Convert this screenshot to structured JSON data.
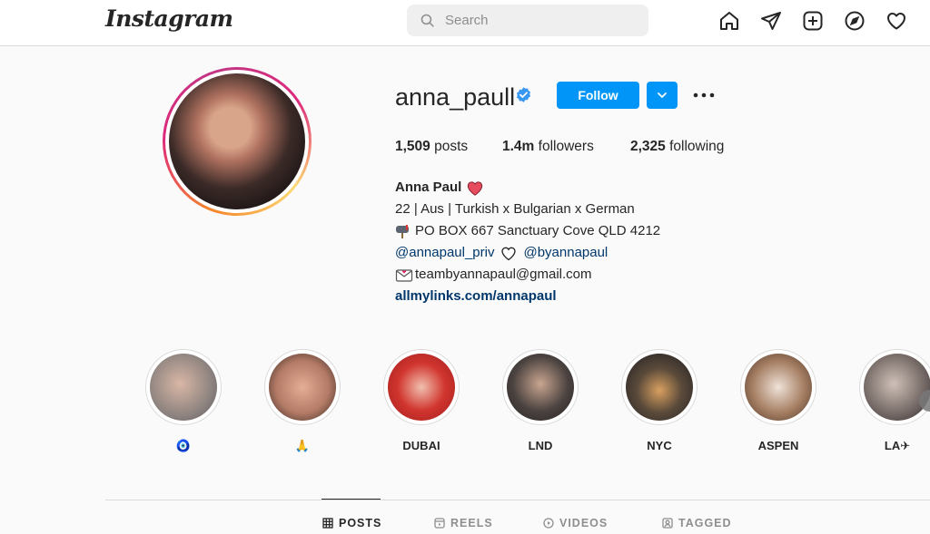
{
  "nav": {
    "logo": "Instagram",
    "search_placeholder": "Search",
    "icons": [
      "home-icon",
      "direct-icon",
      "new-post-icon",
      "explore-icon",
      "activity-icon"
    ]
  },
  "profile": {
    "username": "anna_paull",
    "verified": true,
    "follow_label": "Follow",
    "stats": {
      "posts_count": "1,509",
      "posts_label": "posts",
      "followers_count": "1.4m",
      "followers_label": "followers",
      "following_count": "2,325",
      "following_label": "following"
    },
    "bio": {
      "name": "Anna Paul",
      "line1": "22 | Aus | Turkish x Bulgarian x German",
      "line2": "PO BOX 667 Sanctuary Cove QLD 4212",
      "mention1": "@annapaul_priv",
      "mention2": "@byannapaul",
      "email": "teambyannapaul@gmail.com",
      "link": "allmylinks.com/annapaul"
    }
  },
  "highlights": [
    {
      "label": "🧿",
      "bg": "#9a8f8a"
    },
    {
      "label": "🙏",
      "bg": "#c8917a"
    },
    {
      "label": "DUBAI",
      "bg": "#c0392b"
    },
    {
      "label": "LND",
      "bg": "#4b4340"
    },
    {
      "label": "NYC",
      "bg": "#5a4a3a"
    },
    {
      "label": "ASPEN",
      "bg": "#a57e62"
    },
    {
      "label": "LA✈",
      "bg": "#7a6e6a"
    }
  ],
  "tabs": [
    {
      "label": "POSTS",
      "active": true
    },
    {
      "label": "REELS",
      "active": false
    },
    {
      "label": "VIDEOS",
      "active": false
    },
    {
      "label": "TAGGED",
      "active": false
    }
  ],
  "colors": {
    "accent": "#0095f6",
    "link": "#00376b",
    "text": "#262626",
    "muted": "#8e8e8e"
  }
}
